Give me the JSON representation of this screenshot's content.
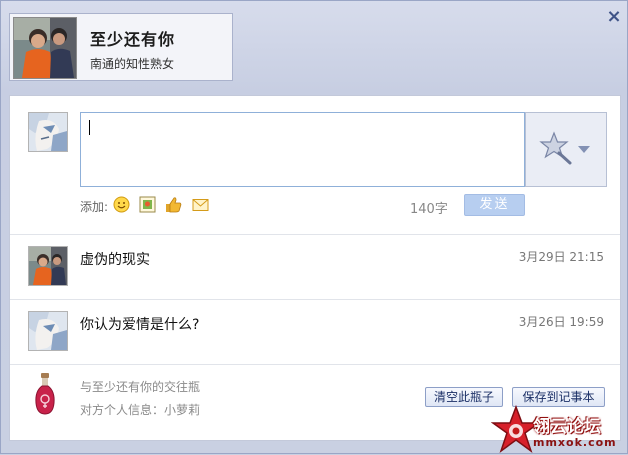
{
  "dialog": {
    "close_label": "×"
  },
  "profile": {
    "name": "至少还有你",
    "subtitle": "南通的知性熟女"
  },
  "composer": {
    "add_label": "添加:",
    "counter": "140字",
    "send_label": "发送",
    "tools": [
      "emoticon-icon",
      "image-icon",
      "thumbs-up-icon",
      "envelope-icon"
    ]
  },
  "messages": [
    {
      "text": "虚伪的现实",
      "time": "3月29日 21:15"
    },
    {
      "text": "你认为爱情是什么?",
      "time": "3月26日 19:59"
    }
  ],
  "footer": {
    "line1": "与至少还有你的交往瓶",
    "line2": "对方个人信息：小萝莉",
    "clear_label": "清空此瓶子",
    "save_label": "保存到记事本"
  },
  "watermark": {
    "brand": "翎云论坛",
    "site": "mmxok.com"
  },
  "colors": {
    "accent": "#3f5387",
    "send_button": "#b7cef0",
    "watermark_red": "#c21b1b"
  }
}
